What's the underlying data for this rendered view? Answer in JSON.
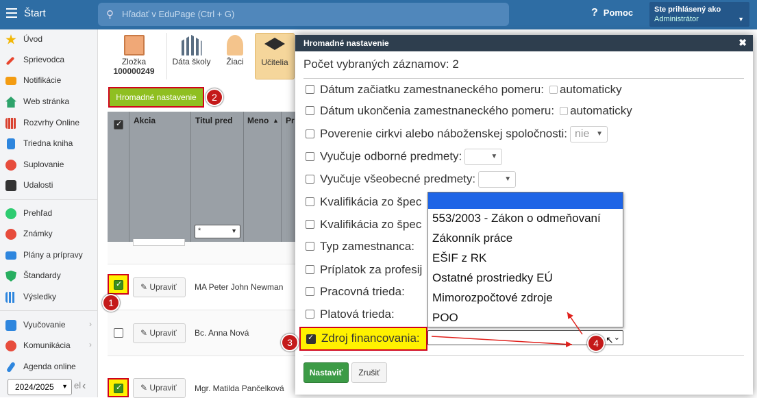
{
  "topbar": {
    "brand": "Štart",
    "search_placeholder": "Hľadať v EduPage (Ctrl + G)",
    "help_label": "Pomoc",
    "user_line1": "Ste prihlásený ako",
    "user_line2": "Administrátor"
  },
  "sidebar": {
    "items": [
      {
        "label": "Úvod",
        "color": "#f2b705"
      },
      {
        "label": "Sprievodca",
        "color": "#e8452e"
      },
      {
        "label": "Notifikácie",
        "color": "#f39c12"
      },
      {
        "label": "Web stránka",
        "color": "#2ea36b"
      },
      {
        "label": "Rozvrhy Online",
        "color": "#d9412f"
      },
      {
        "label": "Triedna kniha",
        "color": "#2e86de"
      },
      {
        "label": "Suplovanie",
        "color": "#e74c3c"
      },
      {
        "label": "Udalosti",
        "color": "#333333"
      },
      {
        "label": "Prehľad",
        "color": "#2ecc71"
      },
      {
        "label": "Známky",
        "color": "#e74c3c"
      },
      {
        "label": "Plány a prípravy",
        "color": "#2e86de"
      },
      {
        "label": "Štandardy",
        "color": "#27ae60"
      },
      {
        "label": "Výsledky",
        "color": "#2e86de"
      },
      {
        "label": "Vyučovanie",
        "color": "#2e86de"
      },
      {
        "label": "Komunikácia",
        "color": "#e74c3c"
      },
      {
        "label": "Agenda online",
        "color": "#2e86de"
      }
    ],
    "year": "2024/2025",
    "year_suffix": "el"
  },
  "toolbar": {
    "folder_label": "Zložka",
    "folder_number": "100000249",
    "school_label": "Dáta školy",
    "students_label": "Žiaci",
    "teachers_label": "Učitelia"
  },
  "bulk_button": "Hromadné nastavenie",
  "grid": {
    "headers": {
      "action": "Akcia",
      "title": "Titul pred",
      "name": "Meno",
      "extra": "Pr"
    },
    "filter_value": "*"
  },
  "rows": [
    {
      "checked": true,
      "edit_label": "Upraviť",
      "name": "MA Peter John Newman"
    },
    {
      "checked": false,
      "edit_label": "Upraviť",
      "name": "Bc. Anna Nová"
    },
    {
      "checked": true,
      "edit_label": "Upraviť",
      "name": "Mgr. Matilda Pančelková"
    }
  ],
  "modal": {
    "title": "Hromadné nastavenie",
    "count": "Počet vybraných záznamov: 2",
    "fields": [
      {
        "label": "Dátum začiatku zamestnaneckého pomeru:",
        "suffix": "automaticky"
      },
      {
        "label": "Dátum ukončenia zamestnaneckého pomeru:",
        "suffix": "automaticky"
      },
      {
        "label": "Poverenie cirkvi alebo náboženskej spoločnosti:",
        "select": "nie"
      },
      {
        "label": "Vyučuje odborné predmety:"
      },
      {
        "label": "Vyučuje všeobecné predmety:"
      },
      {
        "label": "Kvalifikácia zo špec"
      },
      {
        "label": "Kvalifikácia zo špec"
      },
      {
        "label": "Typ zamestnanca:"
      },
      {
        "label": "Príplatok za profesij"
      },
      {
        "label": "Pracovná trieda:"
      },
      {
        "label": "Platová trieda:"
      }
    ],
    "funding_label": "Zdroj financovania:",
    "funding_options": [
      "",
      "553/2003 - Zákon o odmeňovaní",
      "Zákonník práce",
      "EŠIF z RK",
      "Ostatné prostriedky EÚ",
      "Mimorozpočtové zdroje",
      "POO"
    ],
    "ok_label": "Nastaviť",
    "cancel_label": "Zrušiť"
  },
  "annotations": {
    "b1": "1",
    "b2": "2",
    "b3": "3",
    "b4": "4"
  }
}
